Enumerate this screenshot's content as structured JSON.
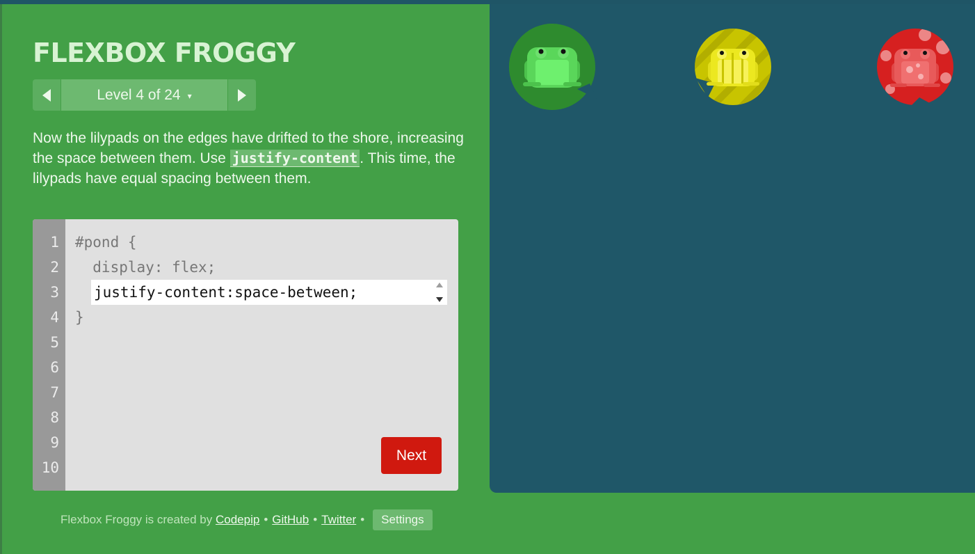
{
  "app": {
    "title": "FLEXBOX FROGGY"
  },
  "level_nav": {
    "prev_icon": "triangle-left-icon",
    "next_icon": "triangle-right-icon",
    "level_label": "Level 4 of 24",
    "caret": "▾"
  },
  "instructions": {
    "part1": "Now the lilypads on the edges have drifted to the shore, increasing the space between them. Use ",
    "code_term": "justify-content",
    "part2": ". This time, the lilypads have equal spacing between them."
  },
  "editor": {
    "line_numbers": [
      "1",
      "2",
      "3",
      "4",
      "5",
      "6",
      "7",
      "8",
      "9",
      "10"
    ],
    "line1": "#pond {",
    "line2": "  display: flex;",
    "input_value": "justify-content:space-between;",
    "line4": "}",
    "next_label": "Next"
  },
  "footer": {
    "credit_text": "Flexbox Froggy is created by",
    "link_codepip": "Codepip",
    "link_github": "GitHub",
    "link_twitter": "Twitter",
    "separator": "•",
    "settings_label": "Settings"
  },
  "pond": {
    "lilypads": [
      {
        "color": "green",
        "pad": "#2e8b2e",
        "frog": "#6ee06e",
        "frog_dark": "#4cc24c"
      },
      {
        "color": "yellow",
        "pad": "#c8c400",
        "frog": "#f7f25a",
        "frog_dark": "#e2dd1a"
      },
      {
        "color": "red",
        "pad": "#d62020",
        "frog": "#f07070",
        "frog_dark": "#e04848"
      }
    ]
  },
  "colors": {
    "background": "#43a047",
    "pond": "#1f5768",
    "next_button": "#d0190f"
  }
}
